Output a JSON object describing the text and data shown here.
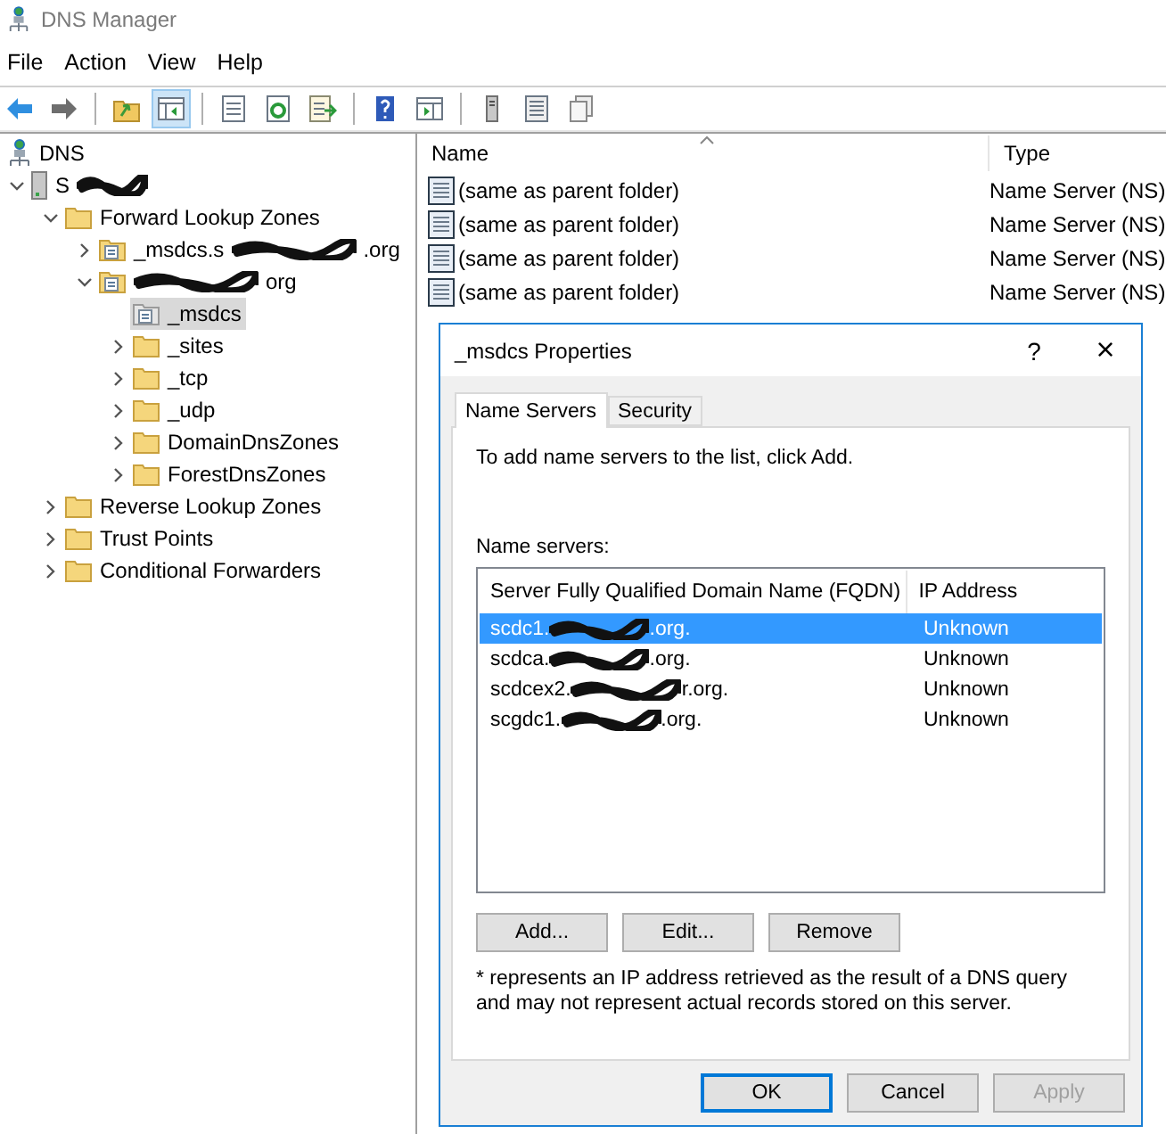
{
  "window": {
    "title": "DNS Manager"
  },
  "menu": [
    "File",
    "Action",
    "View",
    "Help"
  ],
  "toolbar": [
    {
      "kind": "back",
      "pressed": false
    },
    {
      "kind": "forward",
      "pressed": false
    },
    {
      "kind": "separator"
    },
    {
      "kind": "up",
      "pressed": false
    },
    {
      "kind": "tree",
      "pressed": true
    },
    {
      "kind": "separator"
    },
    {
      "kind": "properties",
      "pressed": false
    },
    {
      "kind": "refresh",
      "pressed": false
    },
    {
      "kind": "export",
      "pressed": false
    },
    {
      "kind": "separator"
    },
    {
      "kind": "help",
      "pressed": false
    },
    {
      "kind": "pane",
      "pressed": false
    },
    {
      "kind": "separator"
    },
    {
      "kind": "server",
      "pressed": false
    },
    {
      "kind": "list",
      "pressed": false
    },
    {
      "kind": "copy",
      "pressed": false
    }
  ],
  "tree": [
    {
      "kind": "root",
      "label": "DNS",
      "selected": false,
      "children": [
        {
          "kind": "server",
          "label": "S",
          "redacted": true,
          "expanded": true,
          "selected": false,
          "children": [
            {
              "kind": "folder",
              "label": "Forward Lookup Zones",
              "expanded": true,
              "selected": false,
              "children": [
                {
                  "kind": "zone",
                  "label": "_msdcs.s",
                  "redacted": true,
                  "label_suffix": ".org",
                  "expanded": false,
                  "selected": false
                },
                {
                  "kind": "zone",
                  "redacted": true,
                  "label_suffix": "org",
                  "expanded": true,
                  "selected": false,
                  "children": [
                    {
                      "kind": "delegation",
                      "label": "_msdcs",
                      "selected": true
                    },
                    {
                      "kind": "folder",
                      "label": "_sites",
                      "expanded": false,
                      "selected": false
                    },
                    {
                      "kind": "folder",
                      "label": "_tcp",
                      "expanded": false,
                      "selected": false
                    },
                    {
                      "kind": "folder",
                      "label": "_udp",
                      "expanded": false,
                      "selected": false
                    },
                    {
                      "kind": "folder",
                      "label": "DomainDnsZones",
                      "expanded": false,
                      "selected": false
                    },
                    {
                      "kind": "folder",
                      "label": "ForestDnsZones",
                      "expanded": false,
                      "selected": false
                    }
                  ]
                }
              ]
            },
            {
              "kind": "folder",
              "label": "Reverse Lookup Zones",
              "expanded": false,
              "selected": false
            },
            {
              "kind": "folder",
              "label": "Trust Points",
              "expanded": false,
              "selected": false
            },
            {
              "kind": "folder",
              "label": "Conditional Forwarders",
              "expanded": false,
              "selected": false
            }
          ]
        }
      ]
    }
  ],
  "list": {
    "columns": [
      "Name",
      "Type"
    ],
    "rows": [
      {
        "name": "(same as parent folder)",
        "type": "Name Server (NS)"
      },
      {
        "name": "(same as parent folder)",
        "type": "Name Server (NS)"
      },
      {
        "name": "(same as parent folder)",
        "type": "Name Server (NS)"
      },
      {
        "name": "(same as parent folder)",
        "type": "Name Server (NS)"
      }
    ]
  },
  "dialog": {
    "title": "_msdcs Properties",
    "help": "?",
    "close": "×",
    "tabs": [
      {
        "label": "Name Servers",
        "selected": true
      },
      {
        "label": "Security",
        "selected": false
      }
    ],
    "instruction": "To add name servers to the list, click Add.",
    "list_label": "Name servers:",
    "columns": [
      "Server Fully Qualified Domain Name (FQDN)",
      "IP Address"
    ],
    "servers": [
      {
        "fqdn": "scdc1.",
        "fqdn_suffix": ".org.",
        "ip": "Unknown",
        "selected": true
      },
      {
        "fqdn": "scdca.",
        "fqdn_suffix": ".org.",
        "ip": "Unknown",
        "selected": false
      },
      {
        "fqdn": "scdcex2.",
        "fqdn_suffix": "r.org.",
        "ip": "Unknown",
        "selected": false
      },
      {
        "fqdn": "scgdc1.",
        "fqdn_suffix": ".org.",
        "ip": "Unknown",
        "selected": false
      }
    ],
    "list_buttons": [
      "Add...",
      "Edit...",
      "Remove"
    ],
    "note": "* represents an IP address retrieved as the result of a DNS query and may not represent actual records stored on this server.",
    "footer": [
      {
        "label": "OK",
        "default": true,
        "disabled": false
      },
      {
        "label": "Cancel",
        "default": false,
        "disabled": false
      },
      {
        "label": "Apply",
        "default": false,
        "disabled": true
      }
    ]
  }
}
